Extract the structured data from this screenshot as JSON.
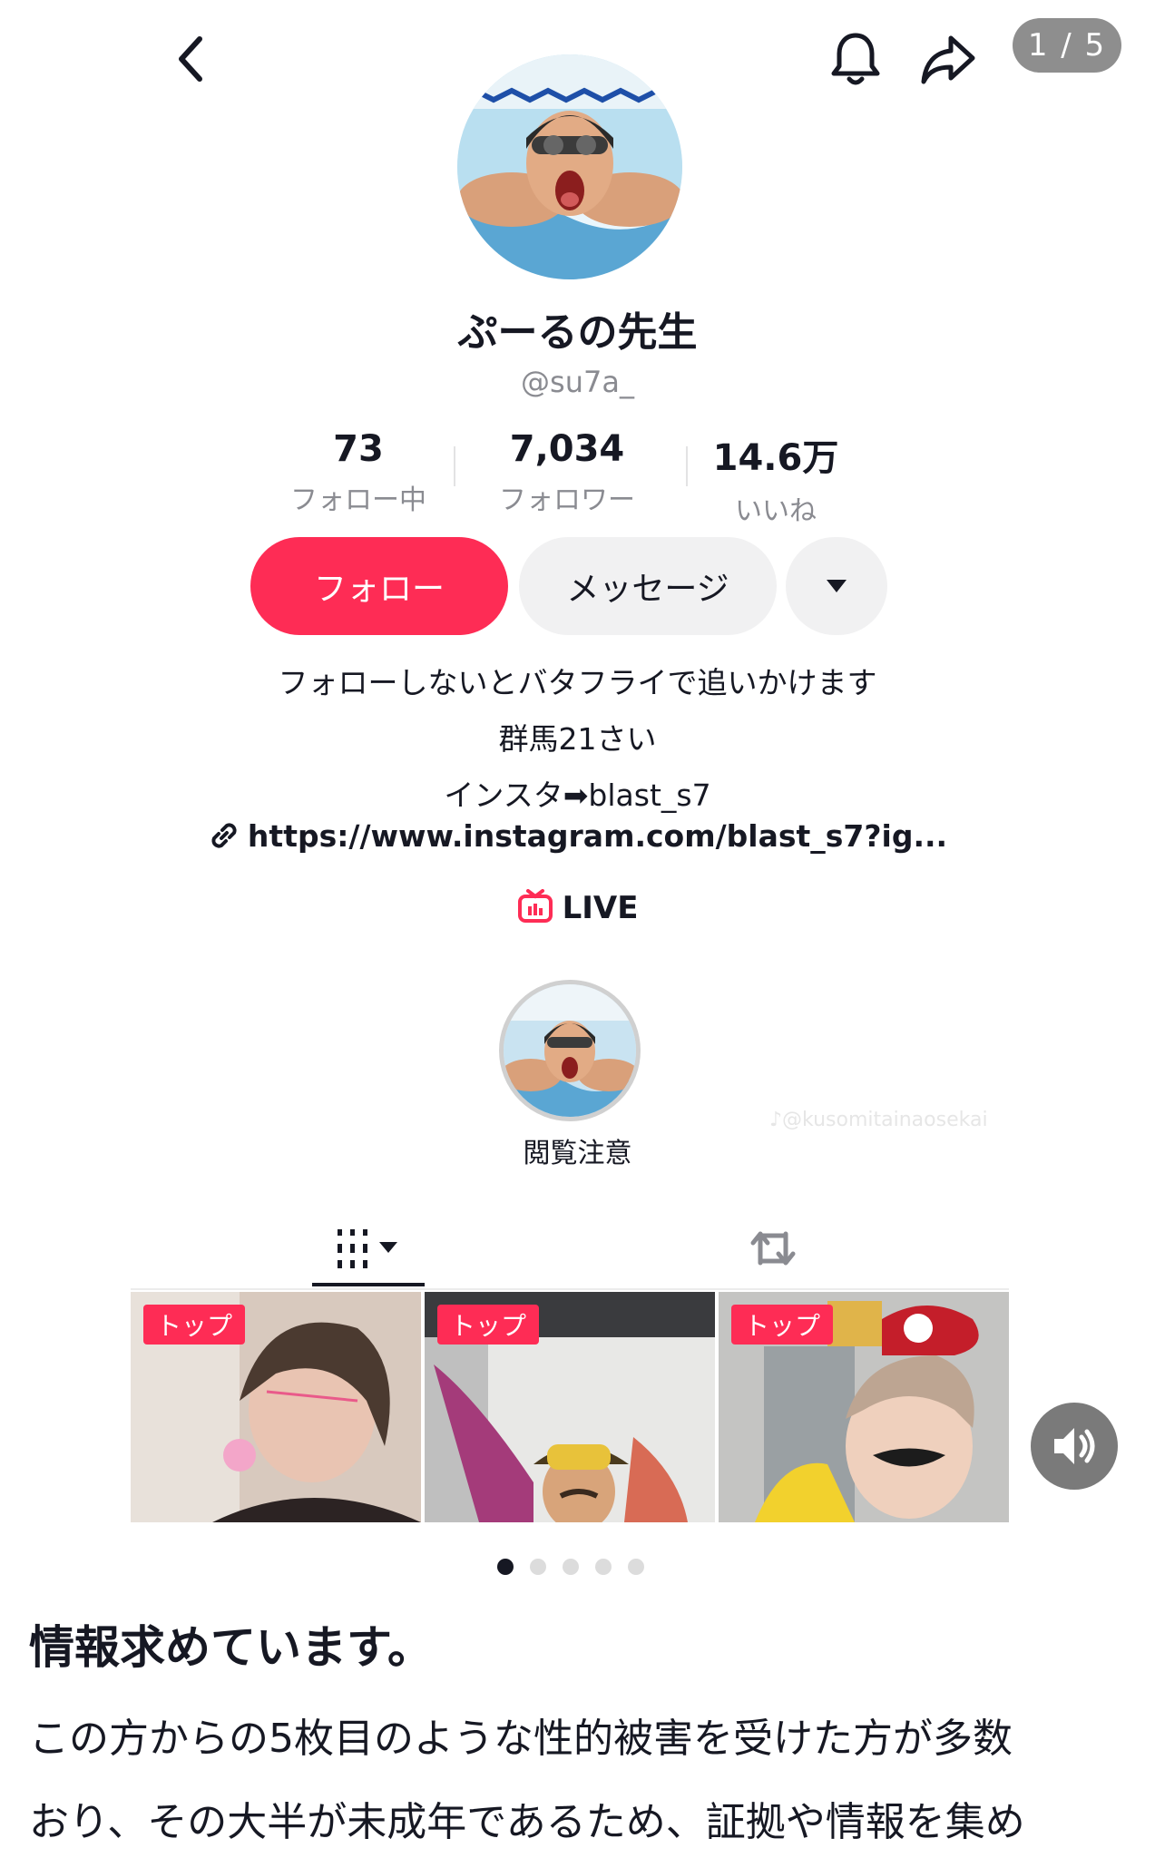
{
  "header": {
    "page_counter": "1 / 5",
    "back_icon": "chevron-left-icon",
    "bell_icon": "bell-icon",
    "share_icon": "share-arrow-icon"
  },
  "profile": {
    "name": "ぷーるの先生",
    "handle": "@su7a_",
    "avatar_icon": "swimmer-avatar"
  },
  "stats": [
    {
      "value": "73",
      "label": "フォロー中"
    },
    {
      "value": "7,034",
      "label": "フォロワー"
    },
    {
      "value": "14.6万",
      "label": "いいね"
    }
  ],
  "actions": {
    "follow_label": "フォロー",
    "message_label": "メッセージ",
    "more_icon": "caret-down-icon"
  },
  "bio": {
    "line1": "フォローしないとバタフライで追いかけます",
    "line2": "群馬21さい",
    "line3": "インスタ➡blast_s7",
    "link": "https://www.instagram.com/blast_s7?ig...",
    "live_label": "LIVE"
  },
  "highlight": {
    "label": "閲覧注意"
  },
  "watermark": "♪@kusomitainaosekai",
  "tabs": {
    "videos_icon": "grid-icon",
    "reposts_icon": "repost-icon"
  },
  "videos": [
    {
      "badge": "トップ"
    },
    {
      "badge": "トップ"
    },
    {
      "badge": "トップ"
    }
  ],
  "carousel": {
    "count": 5,
    "active_index": 0
  },
  "post": {
    "heading": "情報求めています。",
    "line1": "この方からの5枚目のような性的被害を受けた方が多数",
    "line2": "おり、その大半が未成年であるため、証拠や情報を集め"
  },
  "colors": {
    "accent": "#fe2c55",
    "text": "#161823",
    "muted": "#8a8b91",
    "button_gray": "#f1f1f2"
  }
}
